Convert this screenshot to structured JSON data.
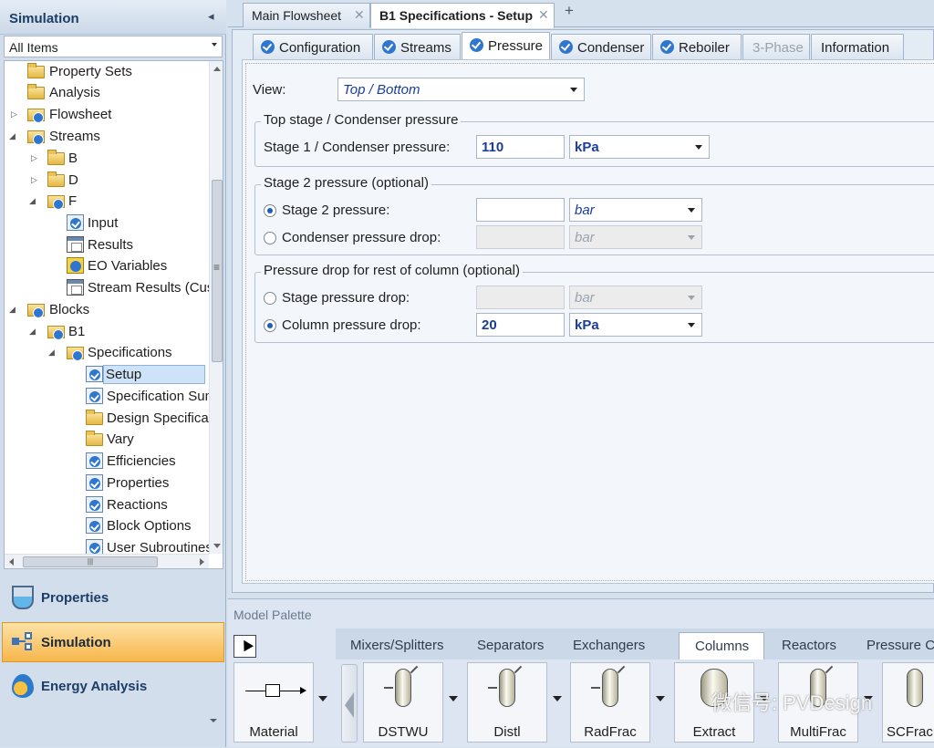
{
  "left": {
    "title": "Simulation",
    "collapse_icon": "chevron-left-icon",
    "filter": "All Items",
    "tree": [
      {
        "label": "Property Sets",
        "icon": "folder-icon"
      },
      {
        "label": "Analysis",
        "icon": "folder-icon"
      },
      {
        "label": "Flowsheet",
        "icon": "folder-checked-icon"
      },
      {
        "label": "Streams",
        "icon": "folder-checked-icon"
      },
      {
        "label": "B",
        "icon": "folder-icon"
      },
      {
        "label": "D",
        "icon": "folder-icon"
      },
      {
        "label": "F",
        "icon": "folder-checked-icon"
      },
      {
        "label": "Input",
        "icon": "form-checked-icon"
      },
      {
        "label": "Results",
        "icon": "results-icon"
      },
      {
        "label": "EO Variables",
        "icon": "eo-variables-icon"
      },
      {
        "label": "Stream Results (Custom)",
        "icon": "results-icon"
      },
      {
        "label": "Blocks",
        "icon": "folder-checked-icon"
      },
      {
        "label": "B1",
        "icon": "folder-checked-icon"
      },
      {
        "label": "Specifications",
        "icon": "folder-checked-icon"
      },
      {
        "label": "Setup",
        "icon": "form-checked-icon"
      },
      {
        "label": "Specification Summary",
        "icon": "form-checked-icon"
      },
      {
        "label": "Design Specifications",
        "icon": "folder-icon"
      },
      {
        "label": "Vary",
        "icon": "folder-icon"
      },
      {
        "label": "Efficiencies",
        "icon": "form-checked-icon"
      },
      {
        "label": "Properties",
        "icon": "form-checked-icon"
      },
      {
        "label": "Reactions",
        "icon": "form-checked-icon"
      },
      {
        "label": "Block Options",
        "icon": "form-checked-icon"
      },
      {
        "label": "User Subroutines",
        "icon": "form-checked-icon"
      }
    ],
    "nav": [
      {
        "label": "Properties",
        "icon": "flask-icon"
      },
      {
        "label": "Simulation",
        "icon": "flowsheet-icon"
      },
      {
        "label": "Energy Analysis",
        "icon": "energy-drop-icon"
      }
    ]
  },
  "doc_tabs": [
    {
      "label": "Main Flowsheet"
    },
    {
      "label": "B1 Specifications - Setup"
    }
  ],
  "form": {
    "subtabs": [
      "Configuration",
      "Streams",
      "Pressure",
      "Condenser",
      "Reboiler",
      "3-Phase",
      "Information"
    ],
    "view_label": "View:",
    "view_value": "Top / Bottom",
    "group1": {
      "title": "Top stage / Condenser pressure",
      "label": "Stage 1 / Condenser pressure:",
      "value": "110",
      "unit": "kPa"
    },
    "group2": {
      "title": "Stage 2 pressure (optional)",
      "opt1_label": "Stage 2 pressure:",
      "opt1_value": "",
      "opt1_unit": "bar",
      "opt2_label": "Condenser pressure drop:",
      "opt2_unit": "bar"
    },
    "group3": {
      "title": "Pressure drop for rest of column (optional)",
      "opt1_label": "Stage pressure drop:",
      "opt1_unit": "bar",
      "opt2_label": "Column pressure drop:",
      "opt2_value": "20",
      "opt2_unit": "kPa"
    }
  },
  "palette": {
    "title": "Model Palette",
    "tabs": [
      "Mixers/Splitters",
      "Separators",
      "Exchangers",
      "Columns",
      "Reactors",
      "Pressure Changers"
    ],
    "active_tab": "Columns",
    "models": [
      "Material",
      "DSTWU",
      "Distl",
      "RadFrac",
      "Extract",
      "MultiFrac",
      "SCFrac"
    ],
    "watermark": "微信号: PVDesign"
  }
}
